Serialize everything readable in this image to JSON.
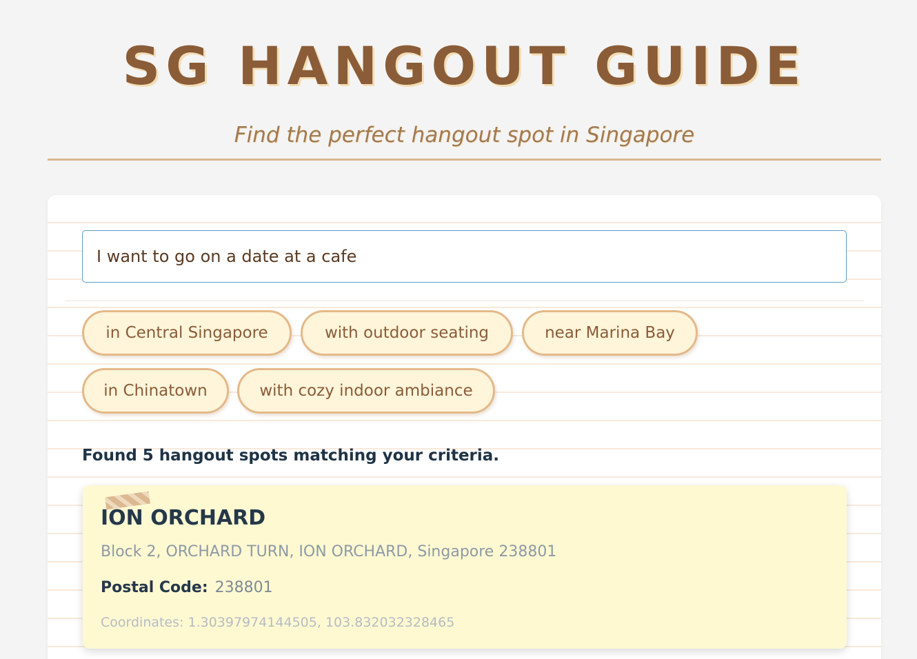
{
  "header": {
    "title": "SG HANGOUT GUIDE",
    "subtitle": "Find the perfect hangout spot in Singapore"
  },
  "search": {
    "value": "I want to go on a date at a cafe",
    "placeholder": ""
  },
  "suggestions": [
    {
      "label": "in Central Singapore"
    },
    {
      "label": "with outdoor seating"
    },
    {
      "label": "near Marina Bay"
    },
    {
      "label": "in Chinatown"
    },
    {
      "label": "with cozy indoor ambiance"
    }
  ],
  "results": {
    "summary": "Found 5 hangout spots matching your criteria.",
    "items": [
      {
        "name": "ION ORCHARD",
        "address": "Block 2, ORCHARD TURN, ION ORCHARD, Singapore 238801",
        "postal_label": "Postal Code:",
        "postal_value": "238801",
        "coordinates": "Coordinates: 1.30397974144505, 103.832032328465"
      }
    ]
  },
  "colors": {
    "background": "#f4f4f4",
    "title": "#8a5c38",
    "chip_background": "#fff5da",
    "chip_border": "#e3b98a",
    "card_background": "#fff9d2",
    "heading_text": "#25384a"
  }
}
